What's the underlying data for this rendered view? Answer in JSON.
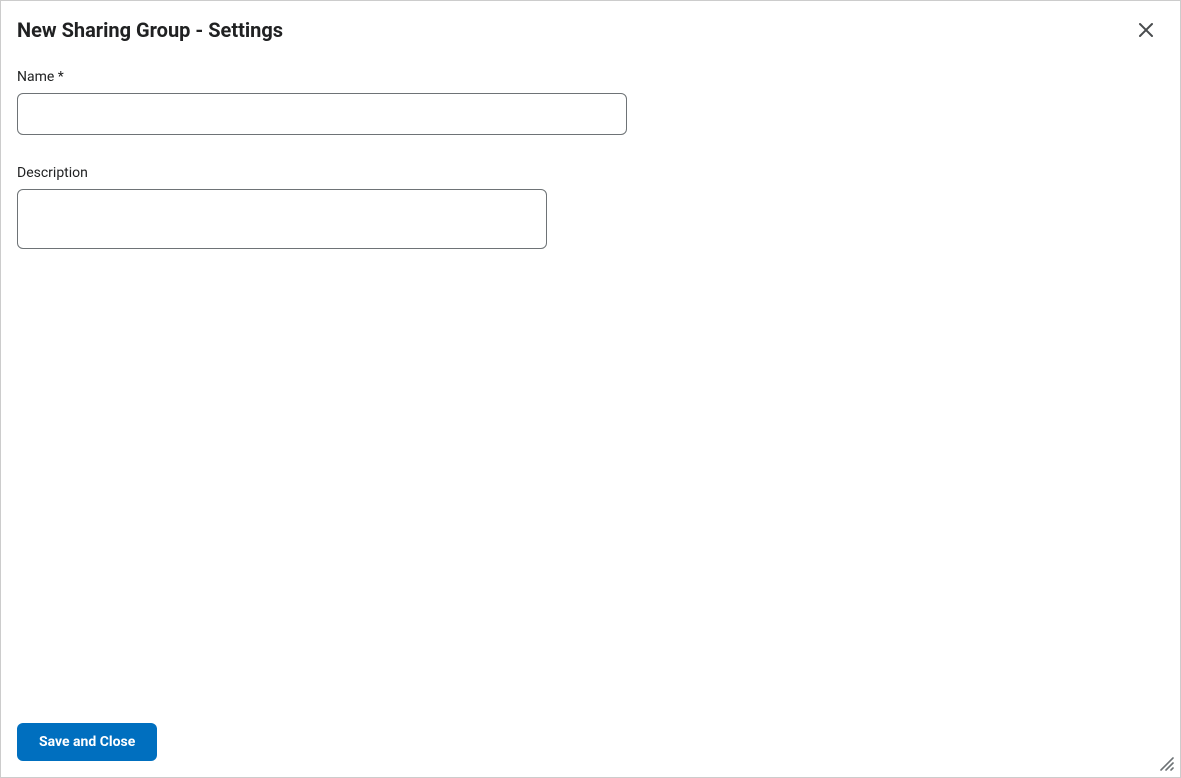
{
  "dialog": {
    "title": "New Sharing Group - Settings"
  },
  "fields": {
    "name": {
      "label": "Name *",
      "value": ""
    },
    "description": {
      "label": "Description",
      "value": ""
    }
  },
  "footer": {
    "save_label": "Save and Close"
  }
}
